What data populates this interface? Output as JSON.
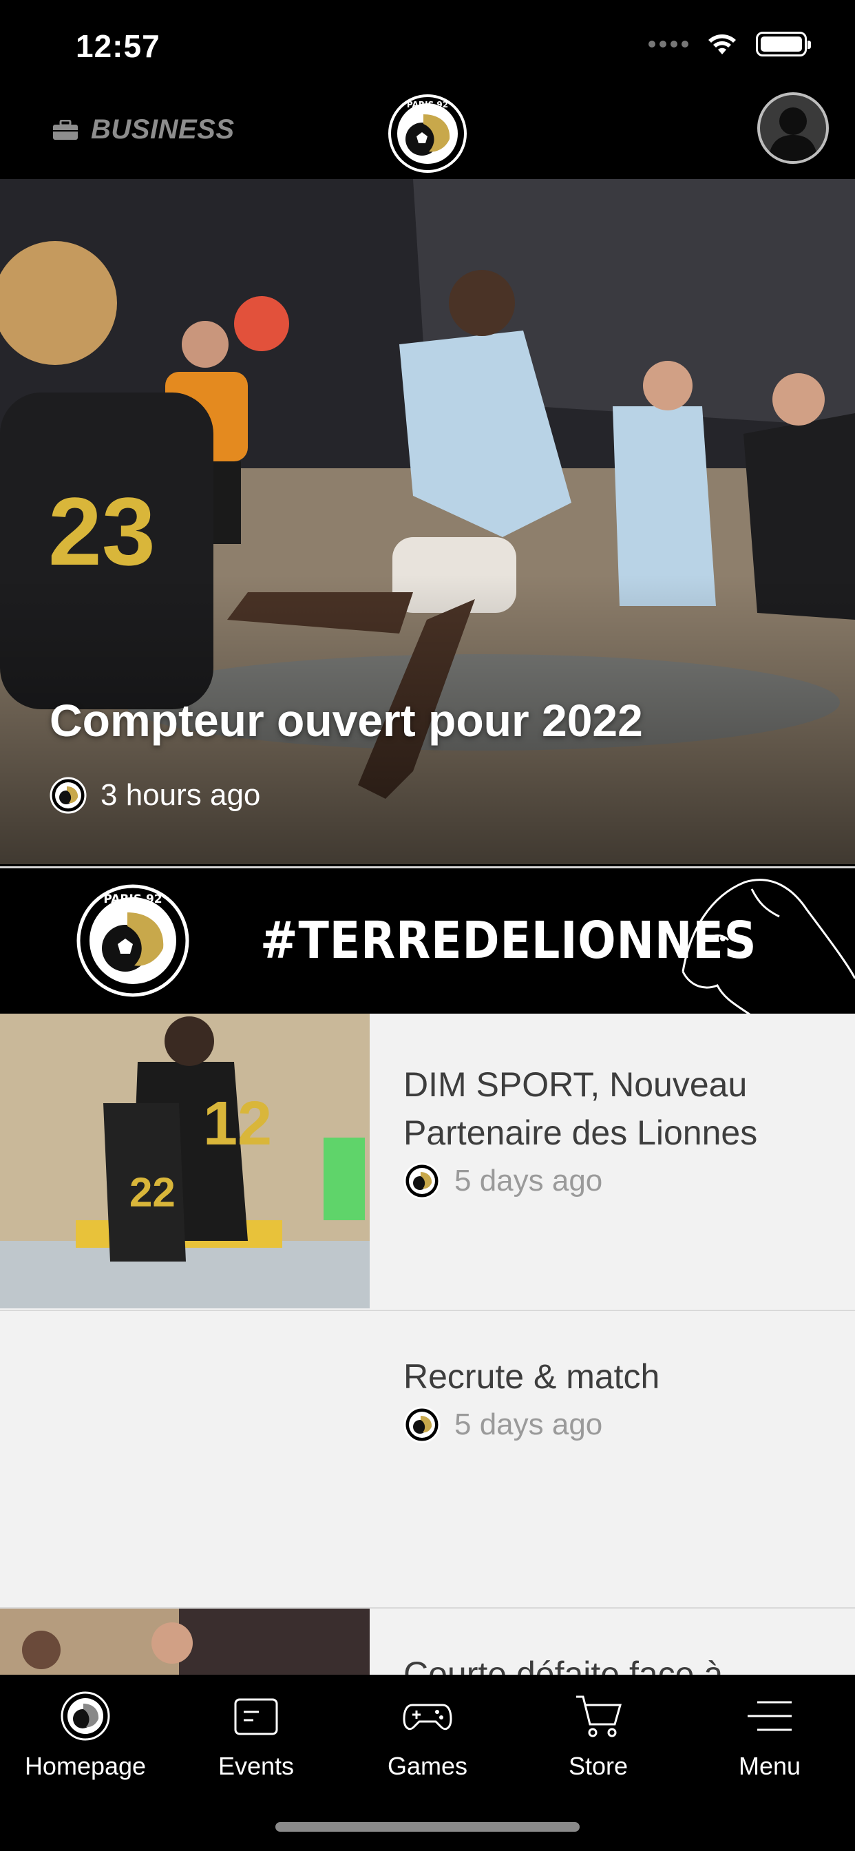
{
  "status_bar": {
    "time": "12:57"
  },
  "header": {
    "business_label": "BUSINESS",
    "logo_text": "PARIS 92"
  },
  "hero": {
    "title": "Compteur ouvert pour 2022",
    "time": "3 hours ago"
  },
  "banner": {
    "hashtag": "#TERREDELIONNES",
    "logo_text": "PARIS 92"
  },
  "news": [
    {
      "title": "DIM SPORT, Nouveau Partenaire des Lionnes",
      "time": "5 days ago",
      "has_thumbnail": true
    },
    {
      "title": "Recrute & match",
      "time": "5 days ago",
      "has_thumbnail": false
    },
    {
      "title": "Courte défaite face à",
      "time": "",
      "has_thumbnail": true
    }
  ],
  "tab_bar": {
    "items": [
      {
        "label": "Homepage",
        "icon": "club-logo-icon"
      },
      {
        "label": "Events",
        "icon": "calendar-icon"
      },
      {
        "label": "Games",
        "icon": "gamepad-icon"
      },
      {
        "label": "Store",
        "icon": "cart-icon"
      },
      {
        "label": "Menu",
        "icon": "menu-icon"
      }
    ]
  },
  "colors": {
    "brand_gold": "#c8a84b",
    "background": "#000000",
    "list_bg": "#f2f2f2",
    "muted_text": "#9a9a9a"
  }
}
